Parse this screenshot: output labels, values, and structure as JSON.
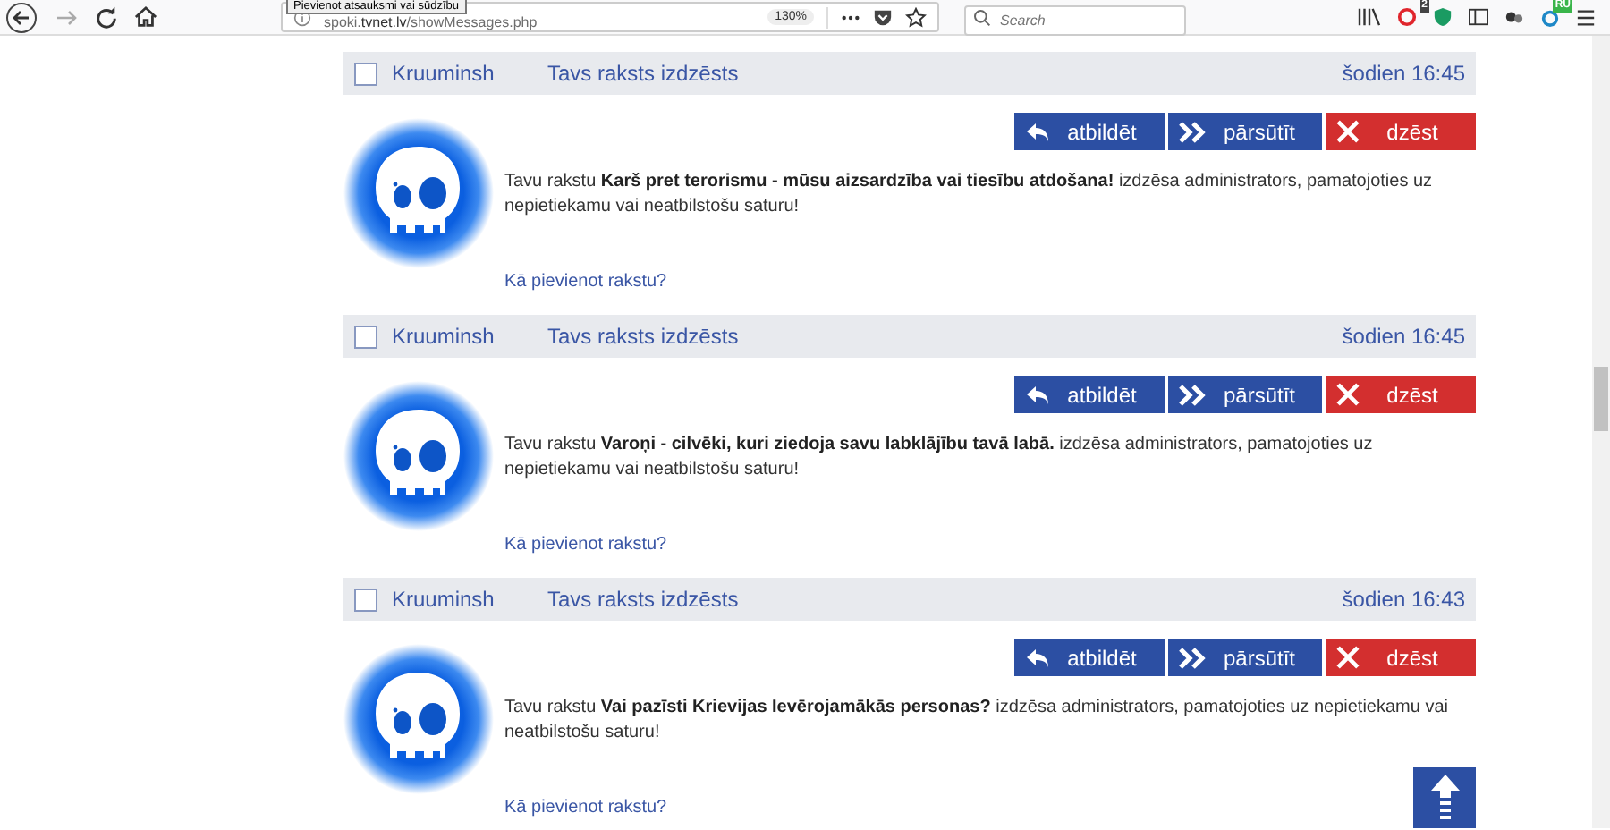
{
  "browser": {
    "tooltip": "Pievienot atsauksmi vai sūdzību",
    "url": "spoki.**tvnet.lv**/showMessages.php",
    "zoom": "130%",
    "search": {
      "placeholder": "Search"
    },
    "forward_disabled": true,
    "notification_badge": "2",
    "language_badge": "RU"
  },
  "messages": [
    {
      "checked": false,
      "sender": "Kruuminsh",
      "subject": "Tavs raksts izdzēsts",
      "time": "šodien 16:45",
      "text": "Tavu rakstu **Karš pret terorismu - mūsu aizsardzība vai tiesību atdošana!** izdzēsa administrators, pamatojoties uz nepietiekamu vai neatbilstošu saturu!",
      "link": "Kā pievienot rakstu?",
      "actions": [
        {
          "kind": "reply",
          "label": "atbildēt"
        },
        {
          "kind": "forward",
          "label": "pārsūtīt"
        },
        {
          "kind": "delete",
          "label": "dzēst"
        }
      ]
    },
    {
      "checked": false,
      "sender": "Kruuminsh",
      "subject": "Tavs raksts izdzēsts",
      "time": "šodien 16:45",
      "text": "Tavu rakstu **Varoņi - cilvēki, kuri ziedoja savu labklājību tavā labā.** izdzēsa administrators, pamatojoties uz nepietiekamu vai neatbilstošu saturu!",
      "link": "Kā pievienot rakstu?",
      "actions": [
        {
          "kind": "reply",
          "label": "atbildēt"
        },
        {
          "kind": "forward",
          "label": "pārsūtīt"
        },
        {
          "kind": "delete",
          "label": "dzēst"
        }
      ]
    },
    {
      "checked": false,
      "sender": "Kruuminsh",
      "subject": "Tavs raksts izdzēsts",
      "time": "šodien 16:43",
      "text": "Tavu rakstu **Vai pazīsti Krievijas Ievērojamākās personas?** izdzēsa administrators, pamatojoties uz nepietiekamu vai neatbilstošu saturu!",
      "link": "Kā pievienot rakstu?",
      "actions": [
        {
          "kind": "reply",
          "label": "atbildēt"
        },
        {
          "kind": "forward",
          "label": "pārsūtīt"
        },
        {
          "kind": "delete",
          "label": "dzēst"
        }
      ]
    }
  ]
}
